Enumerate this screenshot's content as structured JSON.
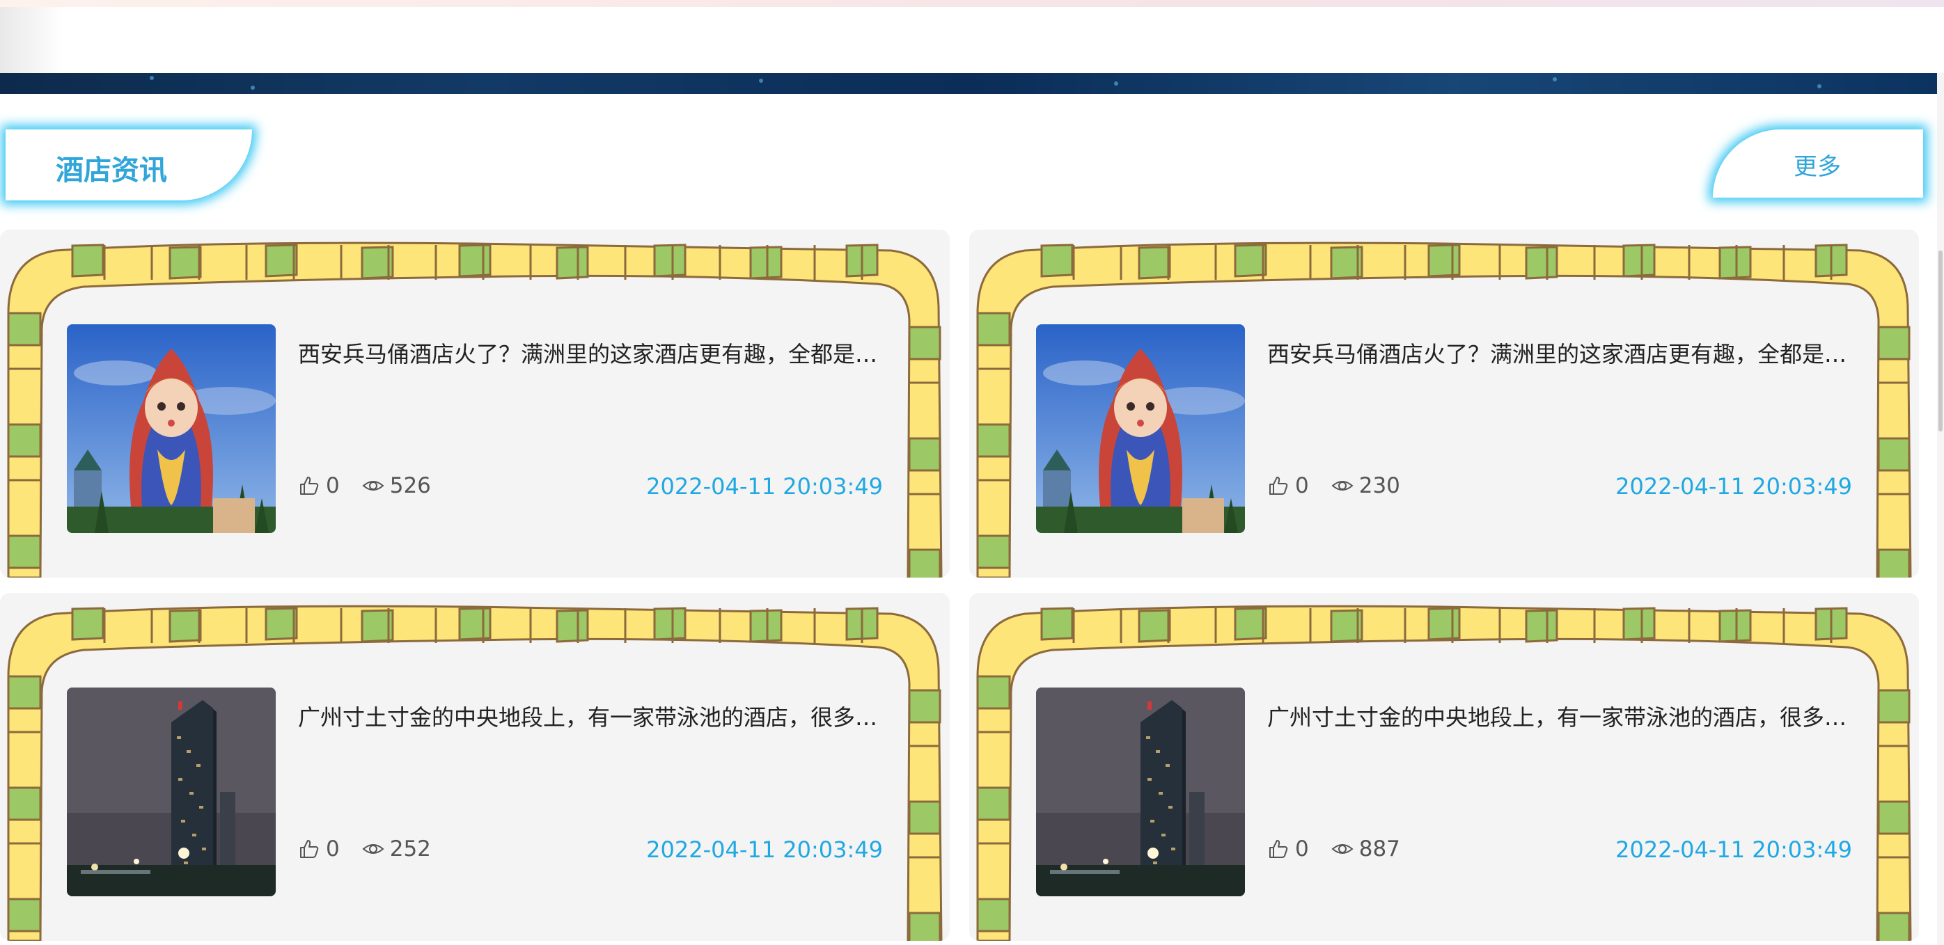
{
  "section": {
    "title": "酒店资讯",
    "more_label": "更多"
  },
  "colors": {
    "accent": "#1fa8e2",
    "glow": "#38c6f2",
    "frame_yellow": "#fde57a",
    "frame_green": "#9cc866",
    "frame_outline": "#8c6a3c",
    "card_bg": "#f4f4f4"
  },
  "icons": [
    "thumbs-up-icon",
    "eye-icon"
  ],
  "news": [
    {
      "title": "西安兵马俑酒店火了？满洲里的这家酒店更有趣，全都是俄罗斯风格的建筑",
      "likes": "0",
      "views": "526",
      "date": "2022-04-11 20:03:49",
      "image": "matryoshka"
    },
    {
      "title": "西安兵马俑酒店火了？满洲里的这家酒店更有趣，全都是俄罗斯风格的建筑",
      "likes": "0",
      "views": "230",
      "date": "2022-04-11 20:03:49",
      "image": "matryoshka"
    },
    {
      "title": "广州寸土寸金的中央地段上，有一家带泳池的酒店，很多人都想去住",
      "likes": "0",
      "views": "252",
      "date": "2022-04-11 20:03:49",
      "image": "tower"
    },
    {
      "title": "广州寸土寸金的中央地段上，有一家带泳池的酒店，很多人都想去住",
      "likes": "0",
      "views": "887",
      "date": "2022-04-11 20:03:49",
      "image": "tower"
    }
  ]
}
